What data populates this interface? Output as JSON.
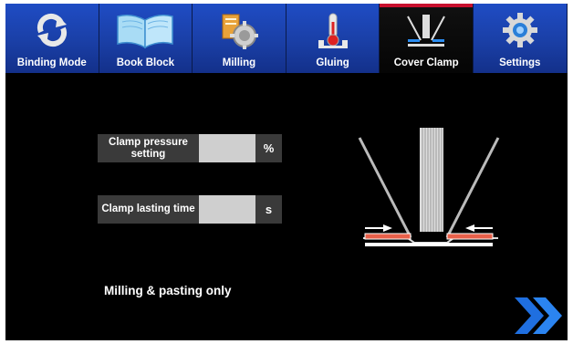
{
  "tabs": [
    {
      "label": "Binding Mode",
      "icon": "refresh-arrows-icon",
      "active": false
    },
    {
      "label": "Book Block",
      "icon": "open-book-icon",
      "active": false
    },
    {
      "label": "Milling",
      "icon": "milling-cutter-icon",
      "active": false
    },
    {
      "label": "Gluing",
      "icon": "thermometer-icon",
      "active": false
    },
    {
      "label": "Cover Clamp",
      "icon": "cover-clamp-icon",
      "active": true
    },
    {
      "label": "Settings",
      "icon": "gear-icon",
      "active": false
    }
  ],
  "fields": {
    "pressure": {
      "label": "Clamp pressure setting",
      "value": "",
      "unit": "%"
    },
    "time": {
      "label": "Clamp lasting time",
      "value": "",
      "unit": "s"
    }
  },
  "mode_text": "Milling & pasting only",
  "next_icon": "double-chevron-right-icon",
  "colors": {
    "tab_blue": "#1a3fa6",
    "active_accent": "#c8102e",
    "clamp_pad": "#e8604a",
    "arrow_blue": "#1f6fe0"
  }
}
